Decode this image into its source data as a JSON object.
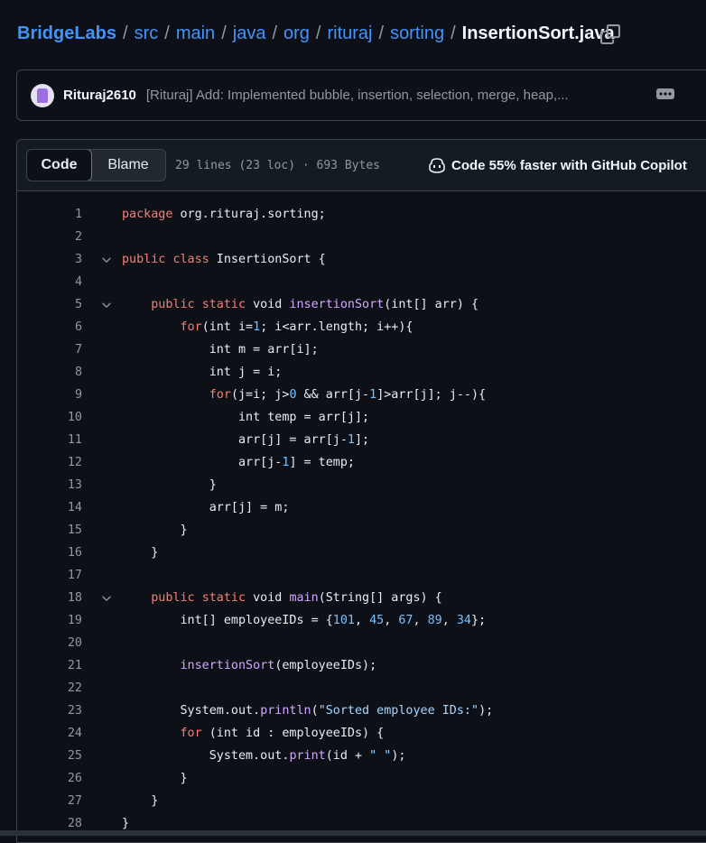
{
  "breadcrumb": {
    "root": "BridgeLabs",
    "parts": [
      "src",
      "main",
      "java",
      "org",
      "rituraj",
      "sorting"
    ],
    "separator": "/",
    "file": "InsertionSort.java"
  },
  "commit": {
    "author": "Rituraj2610",
    "message": "[Rituraj] Add: Implemented bubble, insertion, selection, merge, heap,..."
  },
  "file_header": {
    "tabs": [
      "Code",
      "Blame"
    ],
    "active_tab": "Code",
    "meta": "29 lines (23 loc) · 693 Bytes",
    "copilot": "Code 55% faster with GitHub Copilot"
  },
  "code": {
    "lines": [
      {
        "n": "1",
        "fold": false,
        "tokens": [
          [
            "kw",
            "package"
          ],
          [
            "p",
            " org.rituraj.sorting;"
          ]
        ]
      },
      {
        "n": "2",
        "fold": false,
        "tokens": []
      },
      {
        "n": "3",
        "fold": true,
        "tokens": [
          [
            "kw",
            "public"
          ],
          [
            "p",
            " "
          ],
          [
            "kw",
            "class"
          ],
          [
            "p",
            " InsertionSort {"
          ]
        ]
      },
      {
        "n": "4",
        "fold": false,
        "tokens": []
      },
      {
        "n": "5",
        "fold": true,
        "tokens": [
          [
            "p",
            "    "
          ],
          [
            "kw",
            "public"
          ],
          [
            "p",
            " "
          ],
          [
            "kw",
            "static"
          ],
          [
            "p",
            " void "
          ],
          [
            "fn",
            "insertionSort"
          ],
          [
            "p",
            "(int[] arr) {"
          ]
        ]
      },
      {
        "n": "6",
        "fold": false,
        "tokens": [
          [
            "p",
            "        "
          ],
          [
            "kw",
            "for"
          ],
          [
            "p",
            "(int i="
          ],
          [
            "num",
            "1"
          ],
          [
            "p",
            "; i<arr.length; i++){"
          ]
        ]
      },
      {
        "n": "7",
        "fold": false,
        "tokens": [
          [
            "p",
            "            int m = arr[i];"
          ]
        ]
      },
      {
        "n": "8",
        "fold": false,
        "tokens": [
          [
            "p",
            "            int j = i;"
          ]
        ]
      },
      {
        "n": "9",
        "fold": false,
        "tokens": [
          [
            "p",
            "            "
          ],
          [
            "kw",
            "for"
          ],
          [
            "p",
            "(j=i; j>"
          ],
          [
            "num",
            "0"
          ],
          [
            "p",
            " && arr[j-"
          ],
          [
            "num",
            "1"
          ],
          [
            "p",
            "]>arr[j]; j--){"
          ]
        ]
      },
      {
        "n": "10",
        "fold": false,
        "tokens": [
          [
            "p",
            "                int temp = arr[j];"
          ]
        ]
      },
      {
        "n": "11",
        "fold": false,
        "tokens": [
          [
            "p",
            "                arr[j] = arr[j-"
          ],
          [
            "num",
            "1"
          ],
          [
            "p",
            "];"
          ]
        ]
      },
      {
        "n": "12",
        "fold": false,
        "tokens": [
          [
            "p",
            "                arr[j-"
          ],
          [
            "num",
            "1"
          ],
          [
            "p",
            "] = temp;"
          ]
        ]
      },
      {
        "n": "13",
        "fold": false,
        "tokens": [
          [
            "p",
            "            }"
          ]
        ]
      },
      {
        "n": "14",
        "fold": false,
        "tokens": [
          [
            "p",
            "            arr[j] = m;"
          ]
        ]
      },
      {
        "n": "15",
        "fold": false,
        "tokens": [
          [
            "p",
            "        }"
          ]
        ]
      },
      {
        "n": "16",
        "fold": false,
        "tokens": [
          [
            "p",
            "    }"
          ]
        ]
      },
      {
        "n": "17",
        "fold": false,
        "tokens": []
      },
      {
        "n": "18",
        "fold": true,
        "tokens": [
          [
            "p",
            "    "
          ],
          [
            "kw",
            "public"
          ],
          [
            "p",
            " "
          ],
          [
            "kw",
            "static"
          ],
          [
            "p",
            " void "
          ],
          [
            "fn",
            "main"
          ],
          [
            "p",
            "(String[] args) {"
          ]
        ]
      },
      {
        "n": "19",
        "fold": false,
        "tokens": [
          [
            "p",
            "        int[] employeeIDs = {"
          ],
          [
            "num",
            "101"
          ],
          [
            "p",
            ", "
          ],
          [
            "num",
            "45"
          ],
          [
            "p",
            ", "
          ],
          [
            "num",
            "67"
          ],
          [
            "p",
            ", "
          ],
          [
            "num",
            "89"
          ],
          [
            "p",
            ", "
          ],
          [
            "num",
            "34"
          ],
          [
            "p",
            "};"
          ]
        ]
      },
      {
        "n": "20",
        "fold": false,
        "tokens": []
      },
      {
        "n": "21",
        "fold": false,
        "tokens": [
          [
            "p",
            "        "
          ],
          [
            "fn",
            "insertionSort"
          ],
          [
            "p",
            "(employeeIDs);"
          ]
        ]
      },
      {
        "n": "22",
        "fold": false,
        "tokens": []
      },
      {
        "n": "23",
        "fold": false,
        "tokens": [
          [
            "p",
            "        System.out."
          ],
          [
            "fn",
            "println"
          ],
          [
            "p",
            "("
          ],
          [
            "str",
            "\"Sorted employee IDs:\""
          ],
          [
            "p",
            ");"
          ]
        ]
      },
      {
        "n": "24",
        "fold": false,
        "tokens": [
          [
            "p",
            "        "
          ],
          [
            "kw",
            "for"
          ],
          [
            "p",
            " (int id : employeeIDs) {"
          ]
        ]
      },
      {
        "n": "25",
        "fold": false,
        "tokens": [
          [
            "p",
            "            System.out."
          ],
          [
            "fn",
            "print"
          ],
          [
            "p",
            "(id + "
          ],
          [
            "str",
            "\" \""
          ],
          [
            "p",
            ");"
          ]
        ]
      },
      {
        "n": "26",
        "fold": false,
        "tokens": [
          [
            "p",
            "        }"
          ]
        ]
      },
      {
        "n": "27",
        "fold": false,
        "tokens": [
          [
            "p",
            "    }"
          ]
        ]
      },
      {
        "n": "28",
        "fold": false,
        "tokens": [
          [
            "p",
            "}"
          ]
        ]
      }
    ]
  },
  "colors": {
    "background": "#0d1117",
    "link": "#4493f8",
    "keyword": "#ff7b72",
    "function": "#d2a8ff",
    "number": "#79c0ff",
    "string": "#a5d6ff"
  },
  "icons": [
    "copy-icon",
    "kebab-menu-icon",
    "copilot-icon",
    "chevron-down-icon"
  ]
}
